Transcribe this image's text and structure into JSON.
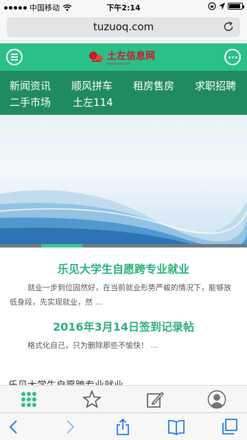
{
  "status": {
    "carrier": "中国移动",
    "time": "下午2:14",
    "battery_level": 0.9
  },
  "browser": {
    "url": "tuzuoq.com"
  },
  "site": {
    "logo_text": "土左信息网",
    "logo_sub": "www.tuzuoq.com"
  },
  "nav": {
    "items": [
      "新闻资讯",
      "顺风拼车",
      "租房售房",
      "求职招聘",
      "二手市场",
      "土左114"
    ]
  },
  "banner": {
    "slide_progress": {
      "current": 2,
      "total": 6
    }
  },
  "articles": [
    {
      "title": "乐见大学生自愿跨专业就业",
      "excerpt": "就业一步到位固然好，在当前就业形势严峻的情况下，能够放低身段，先实现就业，然 ..."
    },
    {
      "title": "2016年3月14日签到记录帖",
      "excerpt": "格式化自己，只为删除那些不愉快！ ..."
    }
  ],
  "cut_text": "乐见大学生自愿跨专业就业",
  "colors": {
    "brand_green": "#2bc088",
    "nav_green": "#208b5e",
    "title_green": "#2bb07a",
    "ios_blue": "#1f7ae0"
  },
  "icons": {
    "sitebar": [
      "grid-icon",
      "star-icon",
      "edit-icon",
      "user-icon"
    ],
    "toolbar": [
      "back-icon",
      "forward-icon",
      "share-icon",
      "bookmarks-icon",
      "tabs-icon"
    ]
  }
}
